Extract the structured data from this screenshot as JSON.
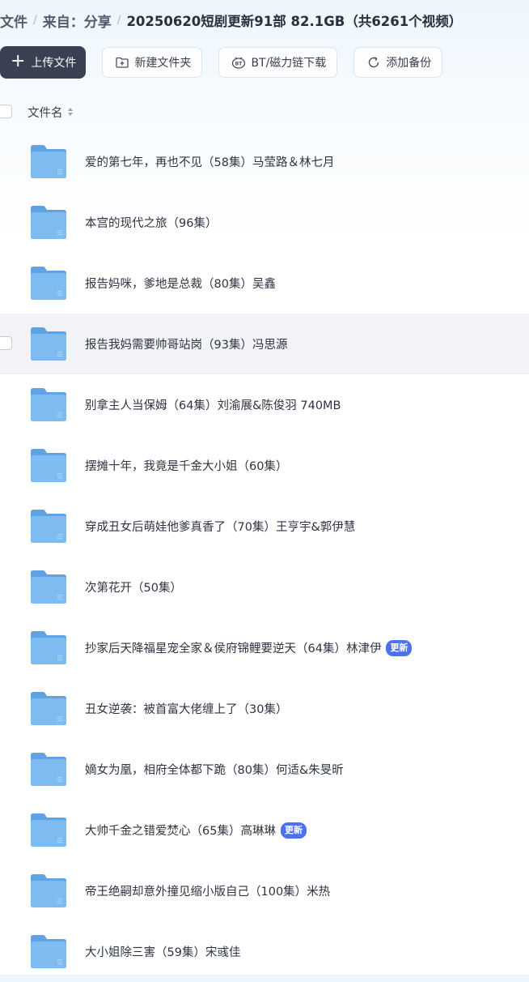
{
  "breadcrumb": {
    "root": "文件",
    "from": "来自：分享",
    "current": "20250620短剧更新91部 82.1GB（共6261个视频）"
  },
  "toolbar": {
    "upload_label": "上传文件",
    "new_folder_label": "新建文件夹",
    "bt_label": "BT/磁力链下载",
    "backup_label": "添加备份"
  },
  "list_header": {
    "name_label": "文件名"
  },
  "files": [
    {
      "name": "爱的第七年，再也不见（58集）马莹路＆林七月",
      "badge": ""
    },
    {
      "name": "本宫的现代之旅（96集）",
      "badge": ""
    },
    {
      "name": "报告妈咪，爹地是总裁（80集）吴鑫",
      "badge": ""
    },
    {
      "name": "报告我妈需要帅哥站岗（93集）冯思源",
      "badge": ""
    },
    {
      "name": "别拿主人当保姆（64集）刘渝展&陈俊羽 740MB",
      "badge": ""
    },
    {
      "name": "摆摊十年，我竟是千金大小姐（60集）",
      "badge": ""
    },
    {
      "name": "穿成丑女后萌娃他爹真香了（70集）王亨宇&郭伊慧",
      "badge": ""
    },
    {
      "name": "次第花开（50集）",
      "badge": ""
    },
    {
      "name": "抄家后天降福星宠全家＆侯府锦鲤要逆天（64集）林津伊",
      "badge": "更新"
    },
    {
      "name": "丑女逆袭：被首富大佬缠上了（30集）",
      "badge": ""
    },
    {
      "name": "嫡女为凰，相府全体都下跪（80集）何适&朱旻昕",
      "badge": ""
    },
    {
      "name": "大帅千金之错爱焚心（65集）高琳琳",
      "badge": "更新"
    },
    {
      "name": "帝王绝嗣却意外撞见缩小版自己（100集）米热",
      "badge": ""
    },
    {
      "name": "大小姐除三害（59集）宋彧佳",
      "badge": ""
    }
  ],
  "colors": {
    "primary_button": "#3a3f52",
    "badge": "#4a72ee",
    "folder": "#74b4ec",
    "hover_row": "#f2f3f6"
  }
}
